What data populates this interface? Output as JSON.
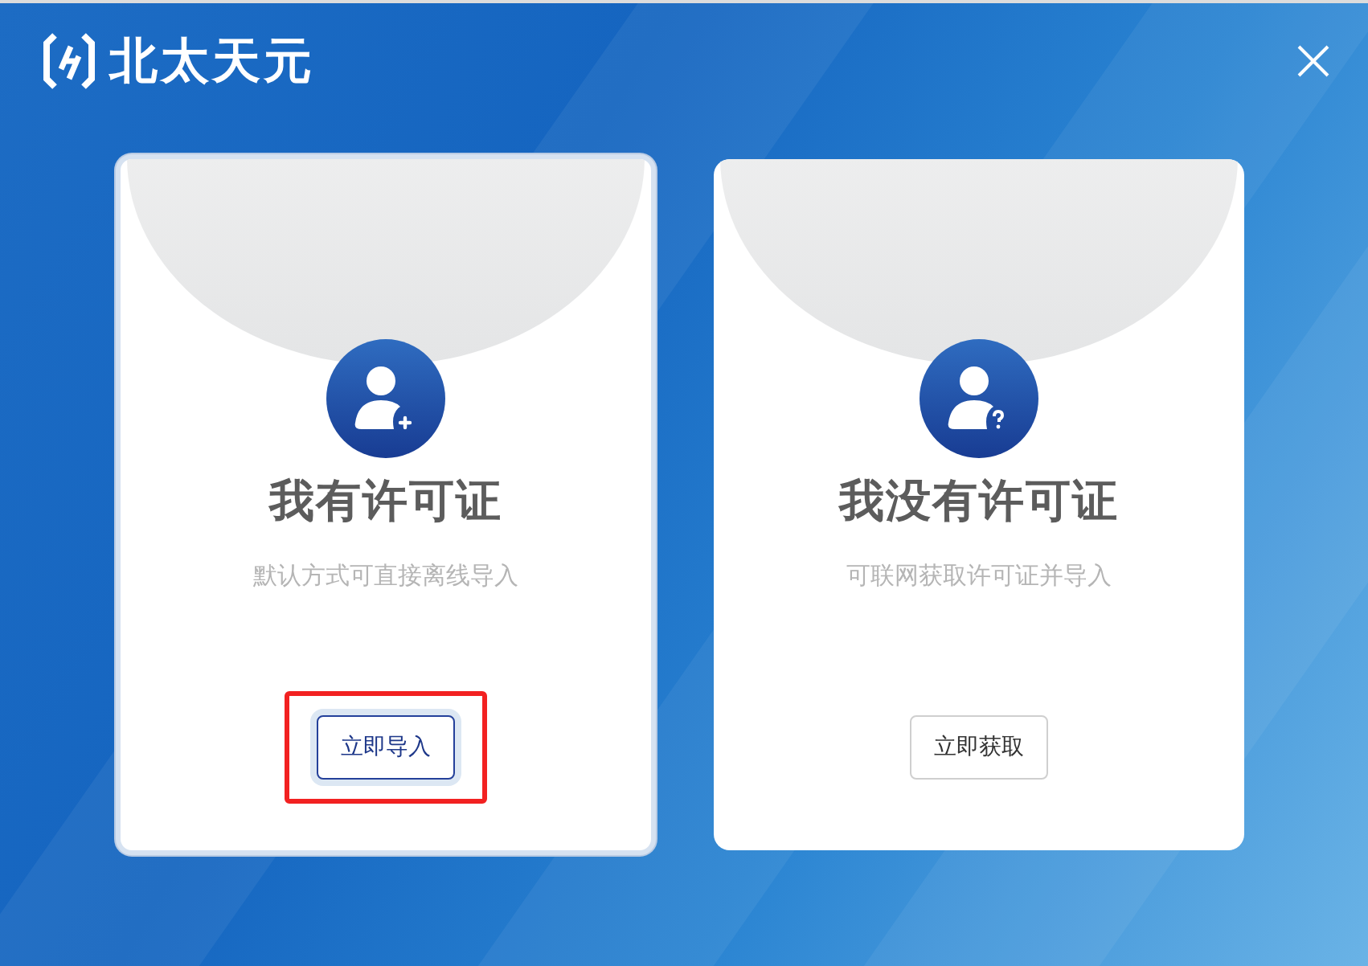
{
  "window": {
    "brand": "北太天元"
  },
  "options": [
    {
      "kind": "import",
      "title": "我有许可证",
      "description": "默认方式可直接离线导入",
      "button": "立即导入",
      "selected": true,
      "highlighted": true
    },
    {
      "kind": "online",
      "title": "我没有许可证",
      "description": "可联网获取许可证并导入",
      "button": "立即获取",
      "selected": false,
      "highlighted": false
    }
  ]
}
